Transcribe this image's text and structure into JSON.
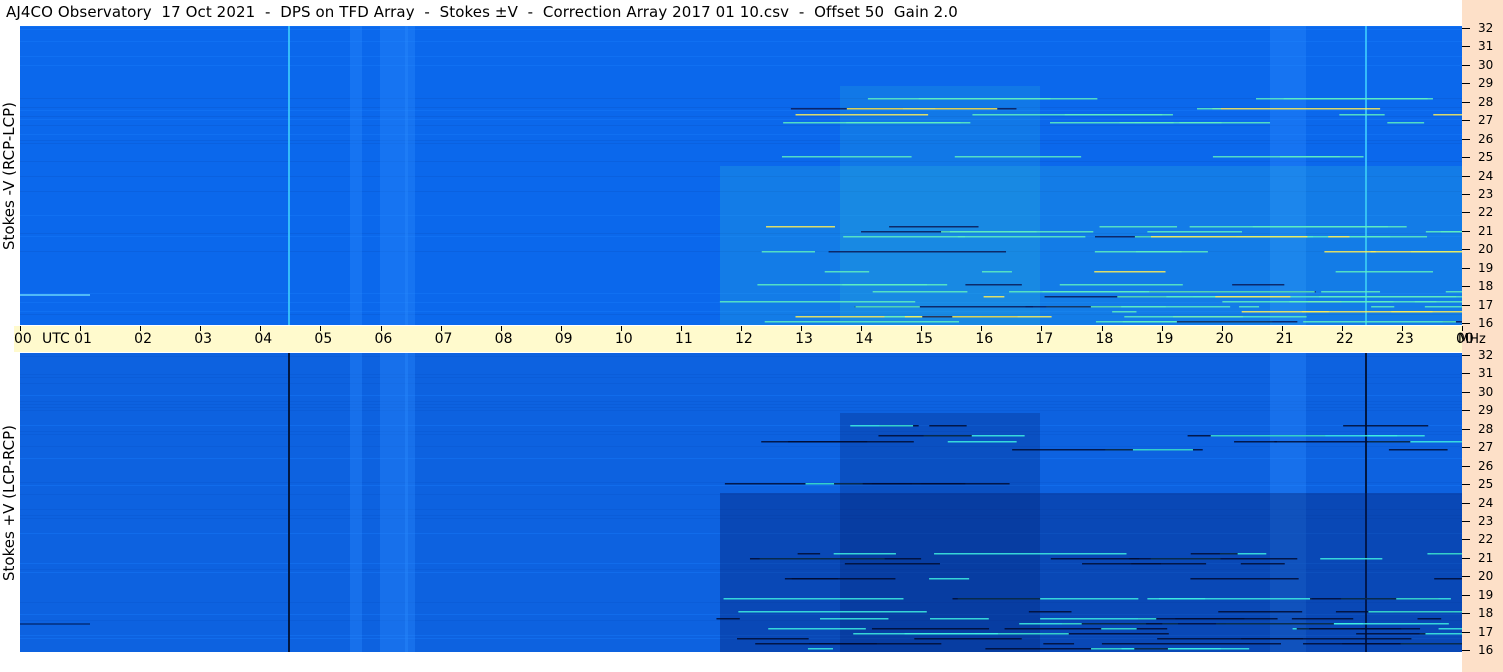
{
  "title": "AJ4CO Observatory  17 Oct 2021  -  DPS on TFD Array  -  Stokes ±V  -  Correction Array 2017 01 10.csv  -  Offset 50  Gain 2.0",
  "panels": {
    "top_label": "Stokes -V (RCP-LCP)",
    "bottom_label": "Stokes +V (LCP-RCP)"
  },
  "time_axis": {
    "labels": [
      "00",
      "UTC",
      "01",
      "02",
      "03",
      "04",
      "05",
      "06",
      "07",
      "08",
      "09",
      "10",
      "11",
      "12",
      "13",
      "14",
      "15",
      "16",
      "17",
      "18",
      "19",
      "20",
      "21",
      "22",
      "23",
      "00"
    ],
    "unit": "MHz"
  },
  "freq_axis": {
    "labels": [
      "32",
      "31",
      "30",
      "29",
      "28",
      "27",
      "26",
      "25",
      "24",
      "23",
      "22",
      "21",
      "20",
      "19",
      "18",
      "17",
      "16"
    ]
  },
  "colors": {
    "background": "#0b6cf0",
    "strip": "#fde0c8",
    "axis_bg": "#fffacd",
    "burst": "#4cf0d0"
  }
}
